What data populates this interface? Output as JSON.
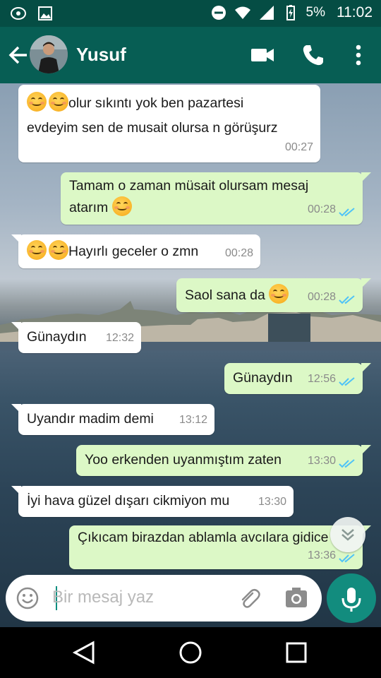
{
  "status_bar": {
    "battery": "5%",
    "time": "11:02"
  },
  "header": {
    "contact_name": "Yusuf"
  },
  "messages": [
    {
      "dir": "in",
      "text": "olur sıkıntı yok ben pazartesi evdeyim sen de musait olursa n görüşurz",
      "line1": "olur sıkıntı yok ben pazartesi",
      "line2": "evdeyim sen de musait olursa n görüşurz",
      "emoji_count": 2,
      "time": "00:27"
    },
    {
      "dir": "out",
      "text": "Tamam o zaman müsait olursam mesaj atarım",
      "line1": "Tamam o zaman müsait olursam mesaj",
      "line2": "atarım",
      "emoji_count": 1,
      "time": "00:28",
      "status": "read"
    },
    {
      "dir": "in",
      "text": "Hayırlı geceler o zmn",
      "emoji_count": 2,
      "time": "00:28"
    },
    {
      "dir": "out",
      "text": "Saol sana da",
      "emoji_count": 1,
      "time": "00:28",
      "status": "read"
    },
    {
      "dir": "in",
      "text": "Günaydın",
      "time": "12:32"
    },
    {
      "dir": "out",
      "text": "Günaydın",
      "time": "12:56",
      "status": "read"
    },
    {
      "dir": "in",
      "text": "Uyandır madim demi",
      "time": "13:12"
    },
    {
      "dir": "out",
      "text": "Yoo erkenden uyanmıştım zaten",
      "time": "13:30",
      "status": "read"
    },
    {
      "dir": "in",
      "text": "İyi hava güzel dışarı cikmiyon mu",
      "time": "13:30"
    },
    {
      "dir": "out",
      "text": "Çıkıcam birazdan ablamla avcılara gidicez",
      "visible_text": "Çıkıcam birazdan ablamla avcılara gidice",
      "time": "13:36",
      "status": "read"
    }
  ],
  "composer": {
    "placeholder": "Bir mesaj yaz"
  },
  "icons": {
    "back": "arrow-left-icon",
    "video": "video-call-icon",
    "call": "phone-icon",
    "menu": "more-vert-icon",
    "emoji": "emoji-icon",
    "attach": "attachment-icon",
    "camera": "camera-icon",
    "mic": "microphone-icon",
    "scroll": "double-chevron-down-icon"
  },
  "colors": {
    "header": "#075e54",
    "status_bar": "#054d44",
    "outgoing_bubble": "#dcf8c6",
    "incoming_bubble": "#ffffff",
    "mic_button": "#128c7e",
    "read_ticks": "#4fc3f7"
  }
}
